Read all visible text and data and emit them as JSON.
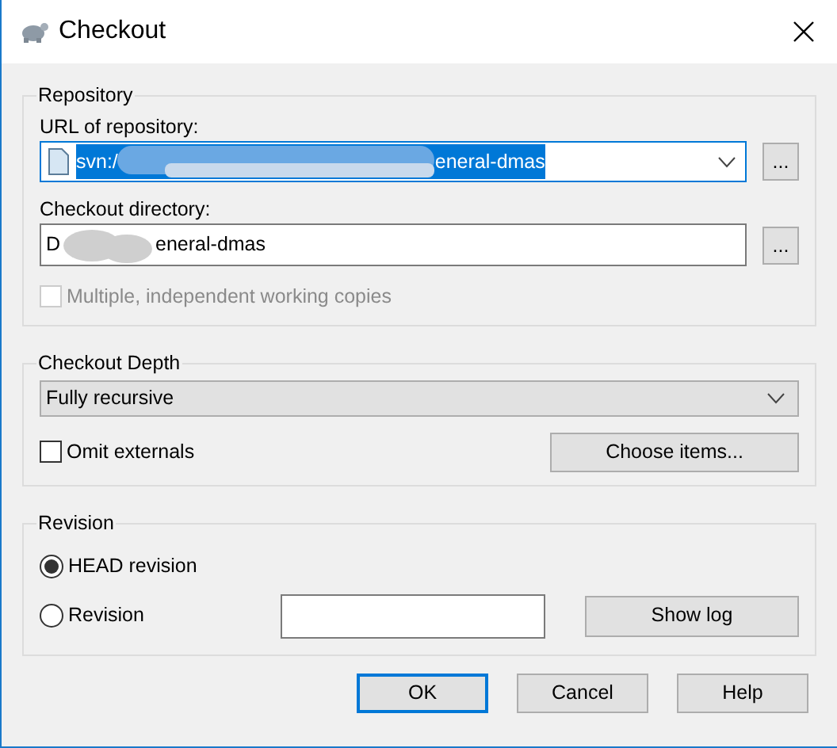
{
  "window": {
    "title": "Checkout"
  },
  "repository": {
    "title": "Repository",
    "url_label": "URL of repository:",
    "url": {
      "visible_start": "svn:/",
      "visible_end": "eneral-dmas",
      "selected": true,
      "redacted": true
    },
    "url_browse": "...",
    "dir_label": "Checkout directory:",
    "dir": {
      "visible_start": "D",
      "visible_end": "eneral-dmas",
      "redacted": true
    },
    "dir_browse": "...",
    "multiple": {
      "label": "Multiple, independent working copies",
      "checked": false,
      "disabled": true
    }
  },
  "depth": {
    "title": "Checkout Depth",
    "value": "Fully recursive",
    "omit_externals": {
      "label": "Omit externals",
      "checked": false,
      "disabled": false
    },
    "choose_items": "Choose items..."
  },
  "revision": {
    "title": "Revision",
    "options": [
      {
        "label": "HEAD revision",
        "selected": true
      },
      {
        "label": "Revision",
        "selected": false
      }
    ],
    "show_log": "Show log"
  },
  "buttons": [
    {
      "label": "OK",
      "default": true
    },
    {
      "label": "Cancel",
      "default": false
    },
    {
      "label": "Help",
      "default": false
    }
  ]
}
